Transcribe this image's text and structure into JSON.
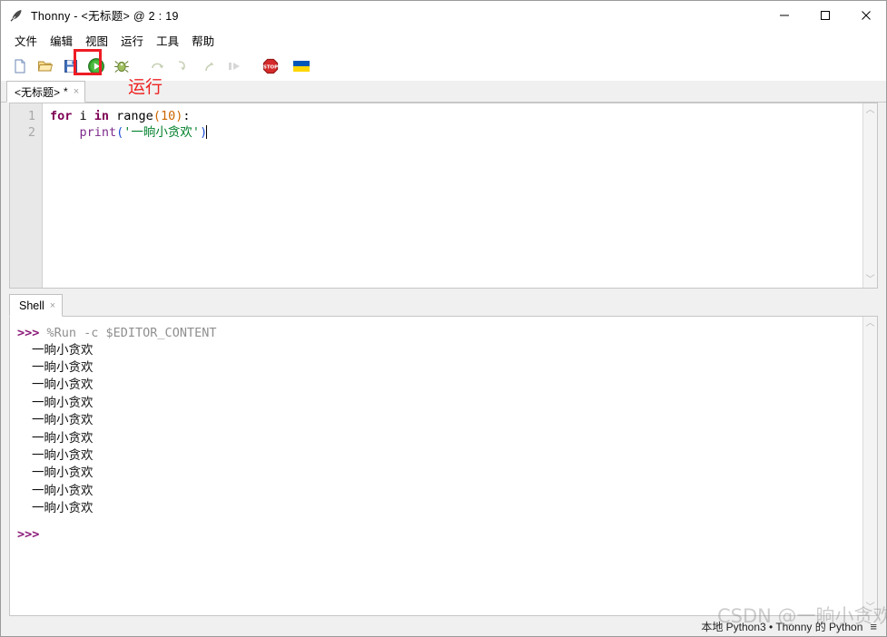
{
  "window": {
    "title": "Thonny  -  <无标题>  @  2 : 19",
    "app_icon": "feather-quill-icon",
    "controls": {
      "minimize": "—",
      "maximize": "□",
      "close": "✕"
    }
  },
  "menubar": {
    "items": [
      {
        "label": "文件",
        "name": "menu-file"
      },
      {
        "label": "编辑",
        "name": "menu-edit"
      },
      {
        "label": "视图",
        "name": "menu-view"
      },
      {
        "label": "运行",
        "name": "menu-run"
      },
      {
        "label": "工具",
        "name": "menu-tools"
      },
      {
        "label": "帮助",
        "name": "menu-help"
      }
    ]
  },
  "toolbar": {
    "buttons": [
      {
        "name": "new-file-icon",
        "title": "新建"
      },
      {
        "name": "open-file-icon",
        "title": "打开"
      },
      {
        "name": "save-file-icon",
        "title": "保存"
      },
      {
        "name": "run-icon",
        "title": "运行"
      },
      {
        "name": "debug-icon",
        "title": "调试"
      },
      {
        "name": "step-over-icon",
        "title": "单步跳过"
      },
      {
        "name": "step-into-icon",
        "title": "单步进入"
      },
      {
        "name": "step-out-icon",
        "title": "单步跳出"
      },
      {
        "name": "resume-icon",
        "title": "继续"
      },
      {
        "name": "stop-icon",
        "title": "停止"
      },
      {
        "name": "ukraine-flag-icon",
        "title": "Ukraine"
      }
    ],
    "annotation": "运行",
    "highlight_color": "#ee1c25"
  },
  "editor": {
    "tab": {
      "label": "<无标题>",
      "modified_marker": "*",
      "close": "×"
    },
    "line_numbers": [
      "1",
      "2"
    ],
    "code": {
      "line1": {
        "kw_for": "for",
        "var_i": " i ",
        "kw_in": "in",
        "fn_range": " range",
        "open_paren": "(",
        "number": "10",
        "close_paren": ")",
        "colon": ":"
      },
      "line2": {
        "indent": "    ",
        "fn_print": "print",
        "open_paren": "(",
        "string": "'一晌小贪欢'",
        "close_paren": ")"
      }
    }
  },
  "shell": {
    "tab": {
      "label": "Shell",
      "close": "×"
    },
    "prompt": ">>>",
    "command": " %Run -c $EDITOR_CONTENT",
    "output_lines": [
      "一晌小贪欢",
      "一晌小贪欢",
      "一晌小贪欢",
      "一晌小贪欢",
      "一晌小贪欢",
      "一晌小贪欢",
      "一晌小贪欢",
      "一晌小贪欢",
      "一晌小贪欢",
      "一晌小贪欢"
    ],
    "final_prompt": ">>>"
  },
  "statusbar": {
    "interpreter": "本地 Python3  •  Thonny 的 Python",
    "menu_icon": "≡"
  },
  "watermark": {
    "text": "CSDN @一晌小贪欢"
  },
  "scrollbar": {
    "up_arrow": "︿",
    "down_arrow": "﹀"
  }
}
